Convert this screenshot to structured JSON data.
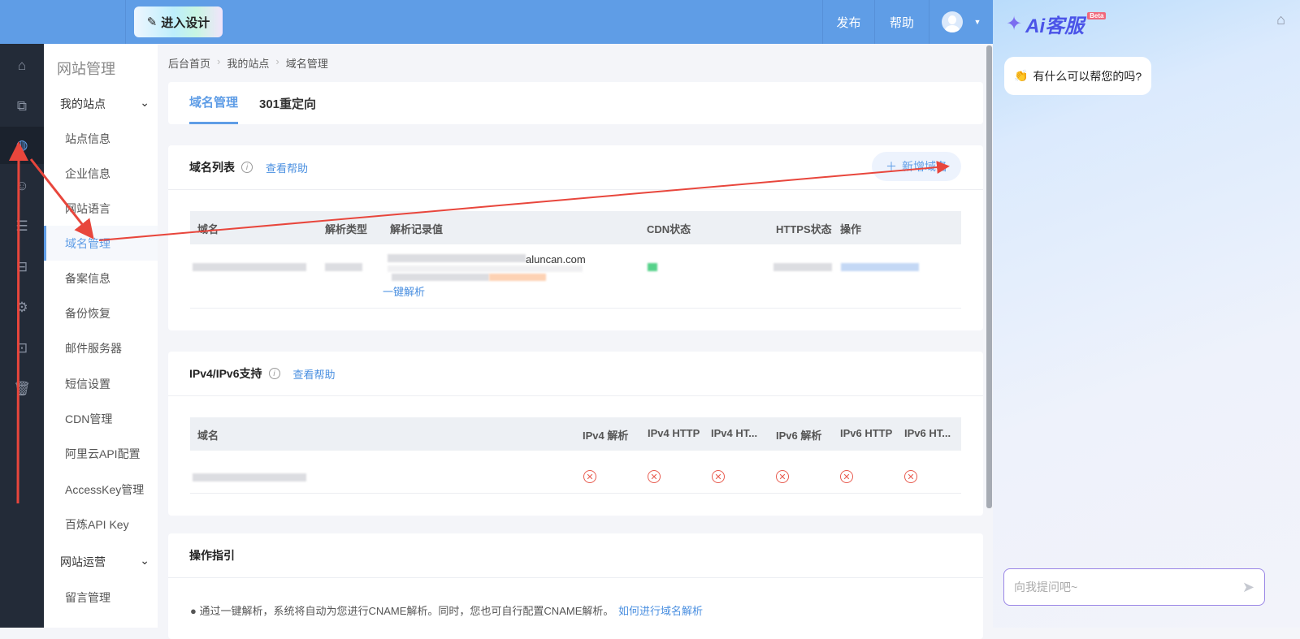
{
  "topbar": {
    "design_label": "进入设计",
    "publish": "发布",
    "help": "帮助"
  },
  "rail_icons": [
    "home-icon",
    "pages-icon",
    "globe-icon",
    "chat-icon",
    "list-icon",
    "bag-icon",
    "gear-icon",
    "terminal-icon",
    "trash-icon"
  ],
  "nav": {
    "title": "网站管理",
    "group1": "我的站点",
    "items": [
      "站点信息",
      "企业信息",
      "网站语言",
      "域名管理",
      "备案信息",
      "备份恢复",
      "邮件服务器",
      "短信设置",
      "CDN管理",
      "阿里云API配置",
      "AccessKey管理",
      "百炼API Key"
    ],
    "group2": "网站运营",
    "items2": [
      "留言管理"
    ]
  },
  "breadcrumb": [
    "后台首页",
    "我的站点",
    "域名管理"
  ],
  "tabs": [
    "域名管理",
    "301重定向"
  ],
  "domain_list": {
    "title": "域名列表",
    "help": "查看帮助",
    "add": "新增域名",
    "headers": [
      "域名",
      "解析类型",
      "解析记录值",
      "CDN状态",
      "HTTPS状态",
      "操作"
    ],
    "record_suffix": "aluncan.com",
    "one_click": "一键解析"
  },
  "ipv": {
    "title": "IPv4/IPv6支持",
    "help": "查看帮助",
    "headers": [
      "域名",
      "IPv4 解析",
      "IPv4 HTTP",
      "IPv4 HT...",
      "IPv6 解析",
      "IPv6 HTTP",
      "IPv6 HT..."
    ]
  },
  "guide": {
    "title": "操作指引",
    "text": "通过一键解析，系统将自动为您进行CNAME解析。同时，您也可自行配置CNAME解析。",
    "link": "如何进行域名解析"
  },
  "ai": {
    "name": "Ai客服",
    "beta": "Beta",
    "greeting": "有什么可以帮您的吗?",
    "placeholder": "向我提问吧~"
  },
  "colors": {
    "primary": "#5f9de6",
    "rail": "#232b38",
    "error": "#e85b4f",
    "annotation": "#e8463c"
  }
}
